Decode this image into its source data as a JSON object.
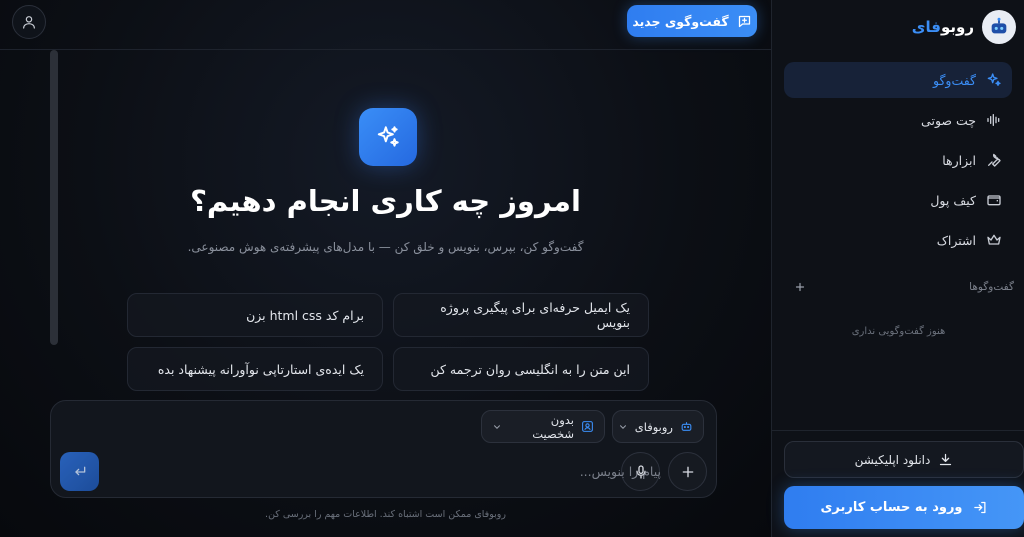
{
  "topbar": {
    "new_chat_label": "گفت‌وگوی جدید",
    "user_icon": "user-icon",
    "new_chat_icon": "message-plus-icon"
  },
  "hero": {
    "title": "امروز چه کاری انجام دهیم؟",
    "subtitle": "گفت‌وگو کن، بپرس، بنویس و خلق کن — با مدل‌های پیشرفته‌ی هوش مصنوعی.",
    "icon": "sparkles-icon"
  },
  "suggestions": [
    "یک ایمیل حرفه‌ای برای پیگیری پروژه بنویس",
    "برام کد html css بزن",
    "این متن را به انگلیسی روان ترجمه کن",
    "یک ایده‌ی استارتاپی نوآورانه پیشنهاد بده"
  ],
  "composer": {
    "model_label": "روبوفای",
    "persona_label": "بدون شخصیت",
    "placeholder": "پیام را بنویس..."
  },
  "disclaimer": "روبوفای ممکن است اشتباه کند. اطلاعات مهم را بررسی کن.",
  "sidebar": {
    "brand_main": "روبو",
    "brand_accent": "فای",
    "items": [
      {
        "label": "گفت‌وگو",
        "icon": "sparkles-icon",
        "active": true
      },
      {
        "label": "چت صوتی",
        "icon": "soundwave-icon",
        "active": false
      },
      {
        "label": "ابزارها",
        "icon": "wrench-icon",
        "active": false
      },
      {
        "label": "کیف پول",
        "icon": "wallet-icon",
        "active": false
      },
      {
        "label": "اشتراک",
        "icon": "crown-icon",
        "active": false
      }
    ],
    "conversations_header": "گفت‌وگوها",
    "empty_note": "هنوز گفت‌وگویی نداری",
    "download_label": "دانلود اپلیکیشن",
    "login_label": "ورود به حساب کاربری"
  },
  "colors": {
    "accent": "#3b8ef6",
    "background": "#0b0d12",
    "sidebar": "#0e1117"
  }
}
